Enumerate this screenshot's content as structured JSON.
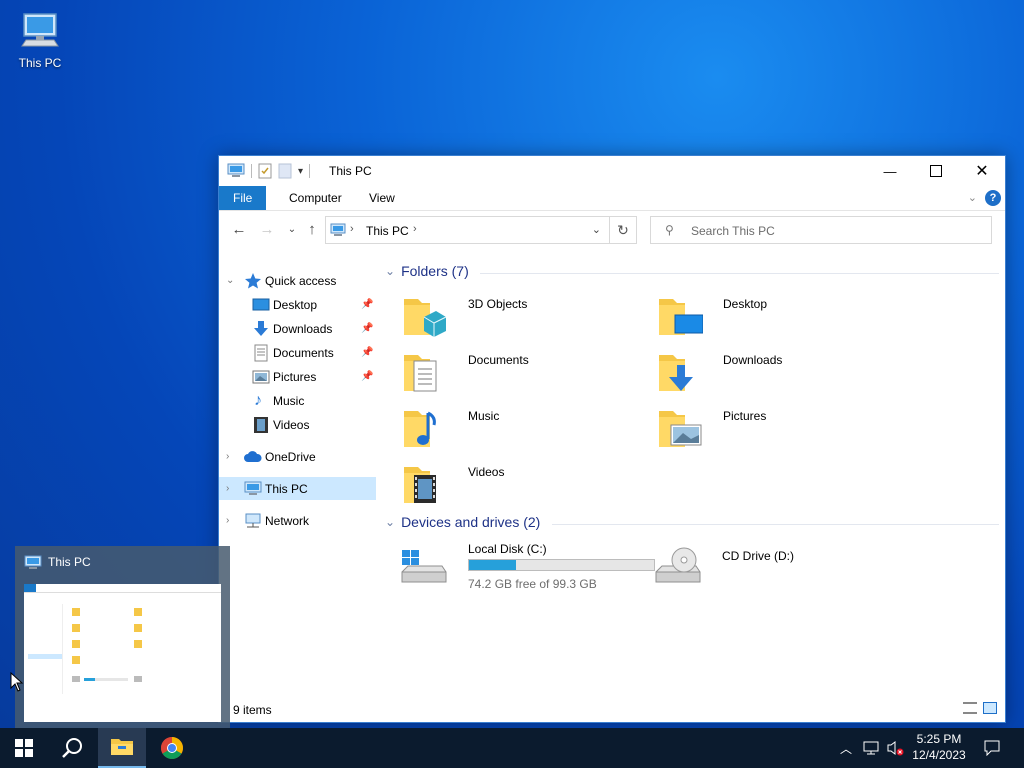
{
  "desktop": {
    "icons": [
      {
        "label": "This PC",
        "icon": "computer-icon"
      }
    ]
  },
  "window": {
    "title": "This PC",
    "ribbon_tabs": [
      "File",
      "Computer",
      "View"
    ],
    "address": {
      "crumb": "This PC"
    },
    "search": {
      "placeholder": "Search This PC"
    },
    "nav": {
      "quick_access": "Quick access",
      "quick_items": [
        {
          "label": "Desktop",
          "pinned": true
        },
        {
          "label": "Downloads",
          "pinned": true
        },
        {
          "label": "Documents",
          "pinned": true
        },
        {
          "label": "Pictures",
          "pinned": true
        },
        {
          "label": "Music",
          "pinned": false
        },
        {
          "label": "Videos",
          "pinned": false
        }
      ],
      "onedrive": "OneDrive",
      "this_pc": "This PC",
      "network": "Network"
    },
    "folders_header": "Folders (7)",
    "folders": [
      {
        "name": "3D Objects",
        "icon": "3d-objects-folder-icon"
      },
      {
        "name": "Desktop",
        "icon": "desktop-folder-icon"
      },
      {
        "name": "Documents",
        "icon": "documents-folder-icon"
      },
      {
        "name": "Downloads",
        "icon": "downloads-folder-icon"
      },
      {
        "name": "Music",
        "icon": "music-folder-icon"
      },
      {
        "name": "Pictures",
        "icon": "pictures-folder-icon"
      },
      {
        "name": "Videos",
        "icon": "videos-folder-icon"
      }
    ],
    "drives_header": "Devices and drives (2)",
    "drives": [
      {
        "name": "Local Disk (C:)",
        "free_text": "74.2 GB free of 99.3 GB",
        "used_fraction": 0.253,
        "icon": "hard-drive-icon"
      },
      {
        "name": "CD Drive (D:)",
        "icon": "cd-drive-icon"
      }
    ],
    "status": "9 items"
  },
  "thumbnail": {
    "title": "This PC"
  },
  "taskbar": {
    "clock_time": "5:25 PM",
    "clock_date": "12/4/2023",
    "accent": "#0078d7"
  }
}
